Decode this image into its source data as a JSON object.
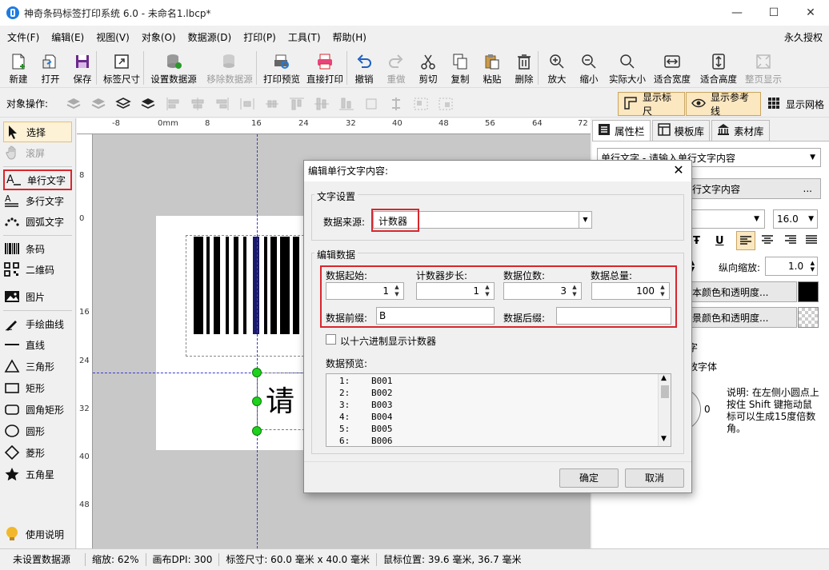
{
  "window": {
    "title": "神奇条码标签打印系统 6.0 - 未命名1.lbcp*",
    "minimize": "—",
    "maximize": "☐",
    "close": "✕"
  },
  "menu": {
    "items": [
      "文件(F)",
      "编辑(E)",
      "视图(V)",
      "对象(O)",
      "数据源(D)",
      "打印(P)",
      "工具(T)",
      "帮助(H)"
    ],
    "license": "永久授权"
  },
  "toolbar": {
    "new": "新建",
    "open": "打开",
    "save": "保存",
    "label_size": "标签尺寸",
    "set_datasource": "设置数据源",
    "remove_datasource": "移除数据源",
    "print_preview": "打印预览",
    "direct_print": "直接打印",
    "undo": "撤销",
    "redo": "重做",
    "cut": "剪切",
    "copy": "复制",
    "paste": "粘贴",
    "delete": "删除",
    "zoom_in": "放大",
    "zoom_out": "缩小",
    "actual_size": "实际大小",
    "fit_width": "适合宽度",
    "fit_height": "适合高度",
    "page_display": "整页显示"
  },
  "objbar": {
    "label": "对象操作:",
    "show_ruler": "显示标尺",
    "show_guides": "显示参考线",
    "show_grid": "显示网格"
  },
  "tools": {
    "select": "选择",
    "scroll": "滚屏",
    "single_text": "单行文字",
    "multi_text": "多行文字",
    "arc_text": "圆弧文字",
    "barcode": "条码",
    "qrcode": "二维码",
    "image": "图片",
    "freehand": "手绘曲线",
    "line": "直线",
    "triangle": "三角形",
    "rect": "矩形",
    "round_rect": "圆角矩形",
    "ellipse": "圆形",
    "diamond": "菱形",
    "star": "五角星",
    "help": "使用说明"
  },
  "ruler": {
    "h": [
      "-8",
      "0mm",
      "8",
      "16",
      "24",
      "32",
      "40",
      "48",
      "56",
      "64",
      "72"
    ],
    "v": [
      "0",
      "8",
      "16",
      "24",
      "32",
      "40",
      "48"
    ]
  },
  "canvas": {
    "text_content": "请辑"
  },
  "rightpanel": {
    "tabs": [
      "属性栏",
      "模板库",
      "素材库"
    ],
    "object_select": "单行文字 - 请输入单行文字内容",
    "content_label": "行文字内容",
    "more": "...",
    "font_size": "16.0",
    "vscale_label": "纵向缩放:",
    "vscale_value": "1.0",
    "text_color_btn": "本颜色和透明度...",
    "bg_color_btn": "景颜色和透明度...",
    "partial1": "字",
    "partial2": "放字体",
    "rotate_value": "0",
    "rotate_note": "说明: 在左侧小圆点上按住 Shift 键拖动鼠标可以生成15度倍数角。",
    "text_color": "#000000"
  },
  "dialog": {
    "title": "编辑单行文字内容:",
    "group_text": "文字设置",
    "datasource_label": "数据来源:",
    "datasource_value": "计数器",
    "group_edit": "编辑数据",
    "start_label": "数据起始:",
    "start_value": "1",
    "step_label": "计数器步长:",
    "step_value": "1",
    "digits_label": "数据位数:",
    "digits_value": "3",
    "total_label": "数据总量:",
    "total_value": "100",
    "prefix_label": "数据前缀:",
    "prefix_value": "B",
    "suffix_label": "数据后缀:",
    "suffix_value": "",
    "hex_label": "以十六进制显示计数器",
    "preview_label": "数据预览:",
    "preview": [
      {
        "n": "1:",
        "v": "B001"
      },
      {
        "n": "2:",
        "v": "B002"
      },
      {
        "n": "3:",
        "v": "B003"
      },
      {
        "n": "4:",
        "v": "B004"
      },
      {
        "n": "5:",
        "v": "B005"
      },
      {
        "n": "6:",
        "v": "B006"
      }
    ],
    "ok": "确定",
    "cancel": "取消"
  },
  "status": {
    "datasource": "未设置数据源",
    "zoom": "缩放: 62%",
    "dpi": "画布DPI: 300",
    "label_size": "标签尺寸: 60.0 毫米 x 40.0 毫米",
    "mouse_pos": "鼠标位置: 39.6 毫米, 36.7 毫米"
  }
}
